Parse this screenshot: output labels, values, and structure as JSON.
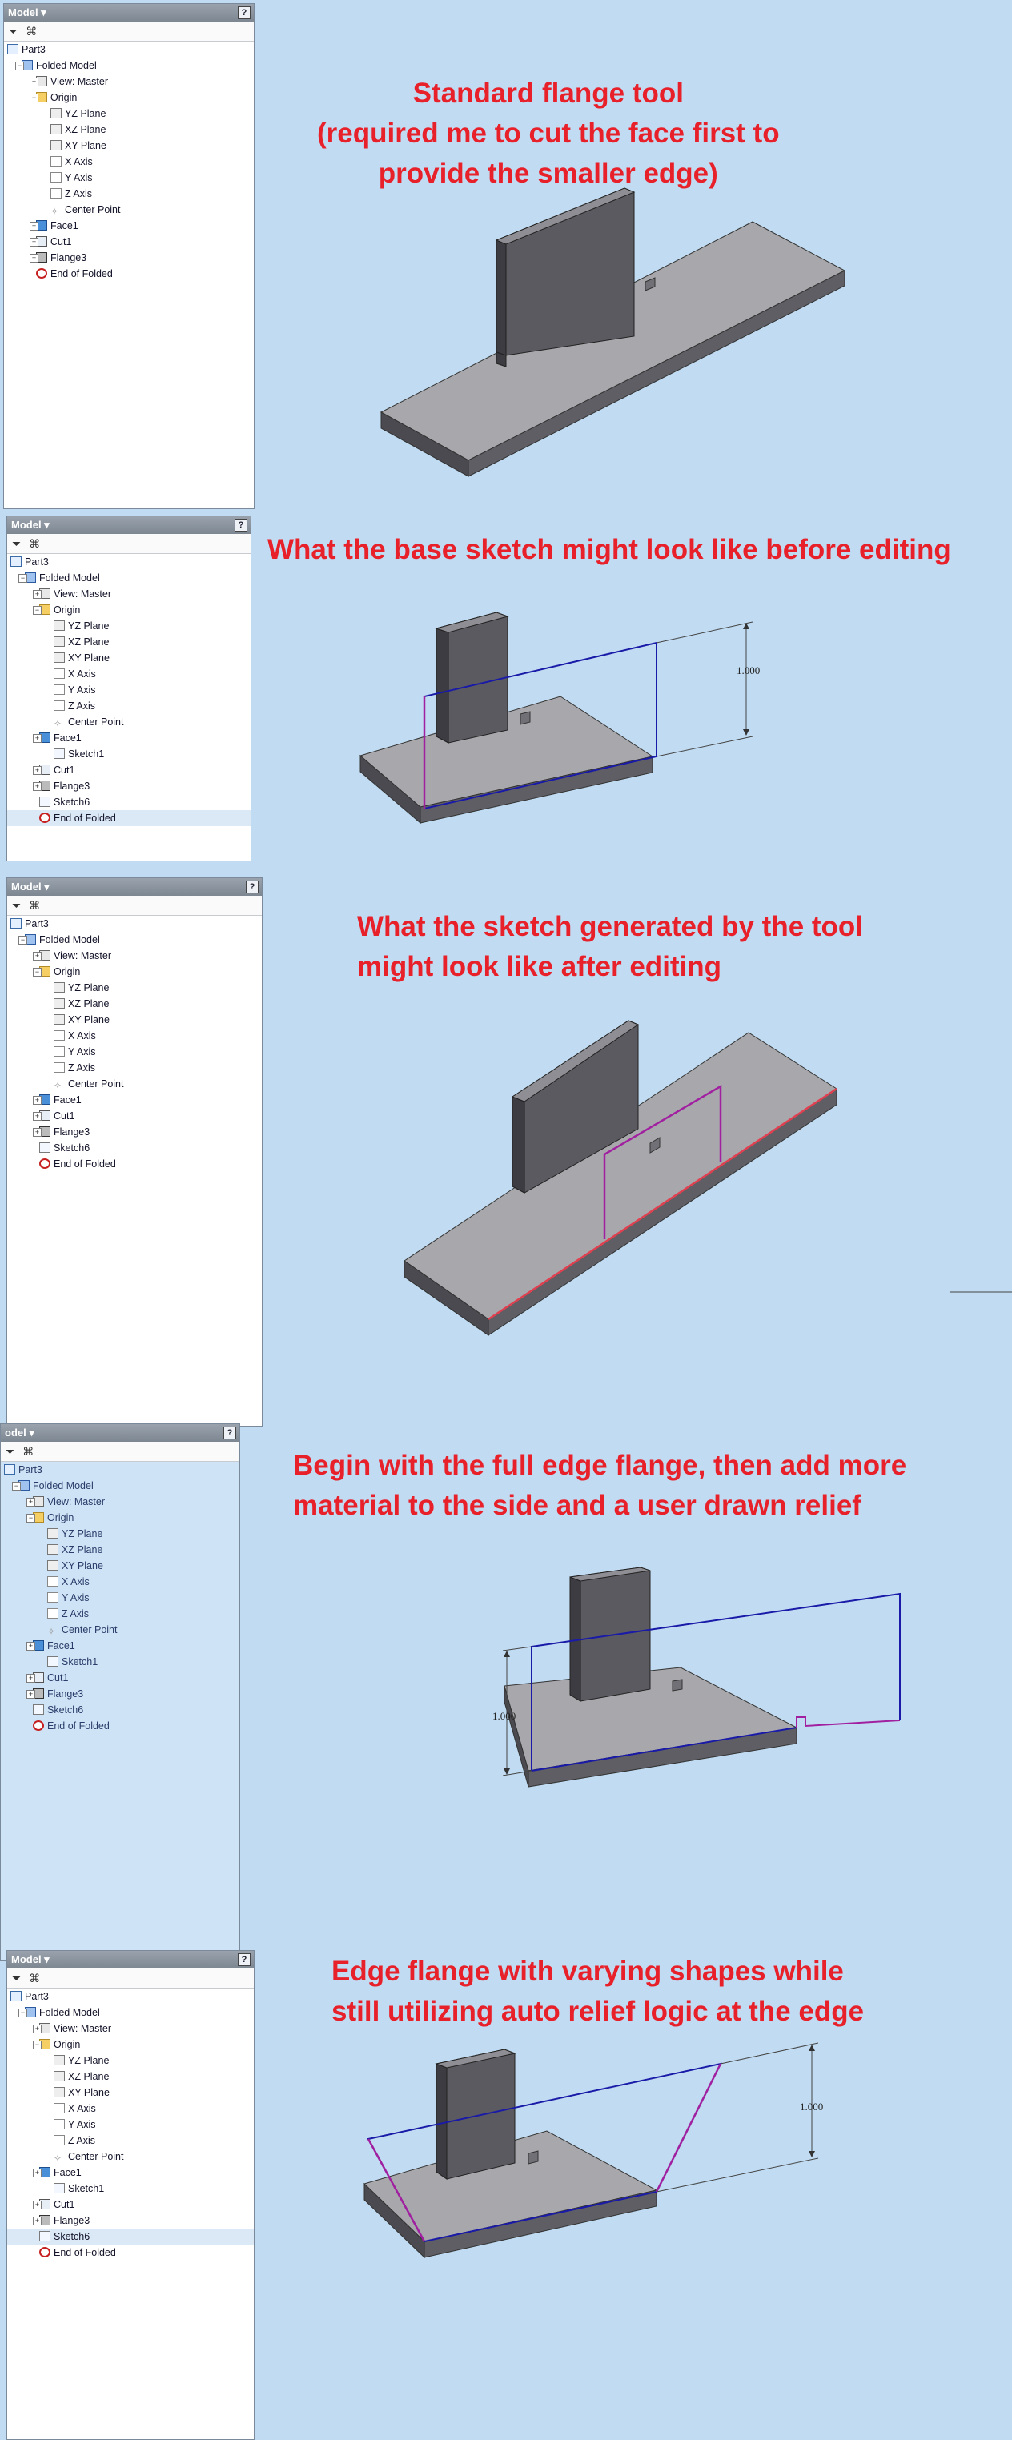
{
  "browser": {
    "title": "Model",
    "help_label": "?",
    "filter_icon": "filter-icon",
    "find_icon": "binoculars-icon"
  },
  "panels": [
    {
      "title": "Model",
      "items": [
        "Part3",
        "Folded Model",
        "View: Master",
        "Origin",
        "YZ Plane",
        "XZ Plane",
        "XY Plane",
        "X Axis",
        "Y Axis",
        "Z Axis",
        "Center Point",
        "Face1",
        "Cut1",
        "Flange3",
        "End of Folded"
      ]
    },
    {
      "title": "Model",
      "items": [
        "Part3",
        "Folded Model",
        "View: Master",
        "Origin",
        "YZ Plane",
        "XZ Plane",
        "XY Plane",
        "X Axis",
        "Y Axis",
        "Z Axis",
        "Center Point",
        "Face1",
        "Sketch1",
        "Cut1",
        "Flange3",
        "Sketch6",
        "End of Folded"
      ]
    },
    {
      "title": "Model",
      "items": [
        "Part3",
        "Folded Model",
        "View: Master",
        "Origin",
        "YZ Plane",
        "XZ Plane",
        "XY Plane",
        "X Axis",
        "Y Axis",
        "Z Axis",
        "Center Point",
        "Face1",
        "Cut1",
        "Flange3",
        "Sketch6",
        "End of Folded"
      ]
    },
    {
      "title": "odel",
      "items": [
        "Part3",
        "Folded Model",
        "View: Master",
        "Origin",
        "YZ Plane",
        "XZ Plane",
        "XY Plane",
        "X Axis",
        "Y Axis",
        "Z Axis",
        "Center Point",
        "Face1",
        "Sketch1",
        "Cut1",
        "Flange3",
        "Sketch6",
        "End of Folded"
      ]
    },
    {
      "title": "Model",
      "items": [
        "Part3",
        "Folded Model",
        "View: Master",
        "Origin",
        "YZ Plane",
        "XZ Plane",
        "XY Plane",
        "X Axis",
        "Y Axis",
        "Z Axis",
        "Center Point",
        "Face1",
        "Sketch1",
        "Cut1",
        "Flange3",
        "Sketch6",
        "End of Folded"
      ]
    }
  ],
  "captions": [
    "Standard flange tool\n(required me to cut the face first to\nprovide the smaller edge)",
    "What the base sketch might look like before editing",
    "What the sketch generated by the tool\nmight look like after editing",
    "Begin with the full edge flange, then add more\nmaterial to the side and a user drawn relief",
    "Edge flange with varying shapes while\nstill utilizing auto relief logic at the edge"
  ],
  "dimensions": {
    "d2": "1.000",
    "d4": "1.000",
    "d5": "1.000"
  },
  "colors": {
    "background": "#c1dcf2",
    "caption_red": "#e8202a",
    "sketch_blue": "#1a1aa8",
    "sketch_magenta": "#a020a0",
    "edge_red": "#e04050",
    "part_top": "#a8a8ac",
    "part_side": "#56565c"
  }
}
